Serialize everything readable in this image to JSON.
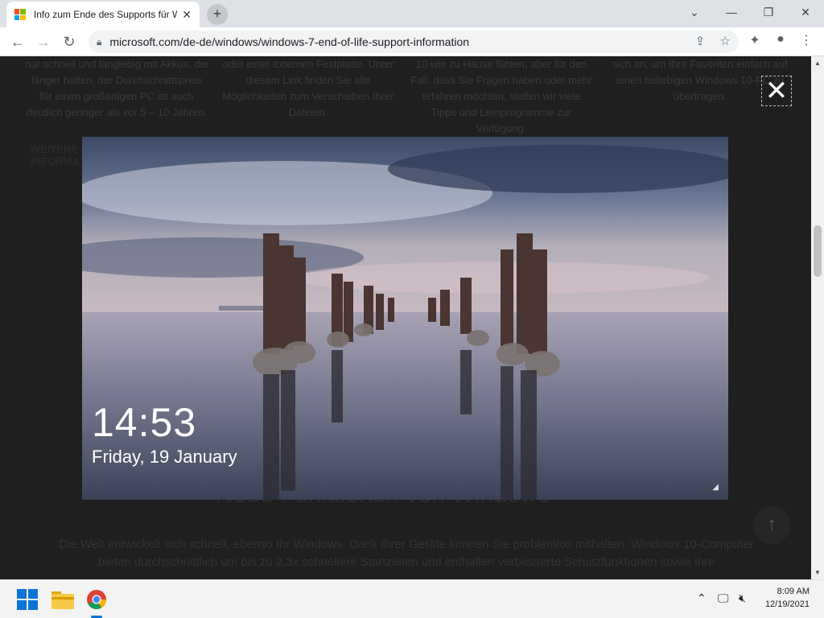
{
  "browser": {
    "tab_title": "Info zum Ende des Supports für W",
    "url": "microsoft.com/de-de/windows/windows-7-end-of-life-support-information",
    "new_tab_symbol": "+",
    "close_tab_symbol": "✕"
  },
  "window_controls": {
    "minimize": "—",
    "maximize": "❐",
    "close": "✕",
    "tab_search": "⌄"
  },
  "toolbar_icons": [
    "back-icon",
    "forward-icon",
    "reload-icon",
    "lock-icon",
    "share-icon",
    "star-icon",
    "extensions-icon",
    "profile-icon",
    "menu-icon"
  ],
  "background_page": {
    "columns": [
      "nur schnell und langlebig mit Akkus, die länger halten, der Durchschnittspreis für einen großartigen PC ist auch deutlich geringer als vor 5 – 10 Jahren.",
      "oder einer externen Festplatte. Unter diesem Link finden Sie alle Möglichkeiten zum Verschieben Ihrer Dateien.",
      "10 wie zu Hause fühlen, aber für den Fall, dass Sie Fragen haben oder mehr erfahren möchten, stellen wir viele Tipps und Lernprogramme zur Verfügung.",
      "sich an, um Ihre Favoriten einfach auf einen beliebigen Windows 10-PC zu übertragen."
    ],
    "more_info": "WEITERE INFORMA",
    "heading": "Neue Funktionen von Windows",
    "paragraph": "Die Welt entwickelt sich schnell, ebenso Ihr Windows. Dank Ihrer Geräte können Sie problemlos mithalten. Windows 10-Computer bieten durchschnittlich um bis zu 2,3x schnellere Startzeiten und enthalten verbesserte Schutzfunktionen sowie ihre"
  },
  "lightbox": {
    "time": "14:53",
    "date": "Friday, 19 January",
    "close_symbol": "✕"
  },
  "scroll_top_symbol": "↑",
  "taskbar": {
    "apps": [
      "start-icon",
      "file-explorer-icon",
      "chrome-icon"
    ],
    "time": "8:09 AM",
    "date": "12/19/2021"
  }
}
